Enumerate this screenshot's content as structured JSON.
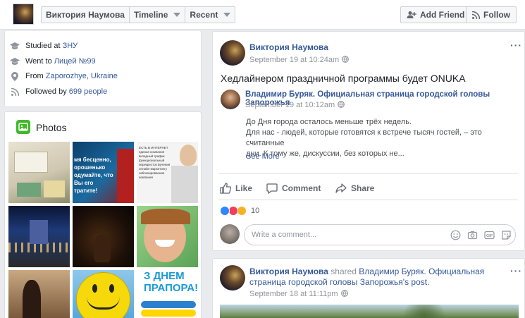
{
  "topbar": {
    "name": "Виктория Наумова",
    "timeline": "Timeline",
    "recent": "Recent",
    "add_friend": "Add Friend",
    "follow": "Follow"
  },
  "intro": {
    "studied_prefix": "Studied at ",
    "studied_link": "ЗНУ",
    "went_prefix": "Went to ",
    "went_link": "Лицей №99",
    "from_prefix": "From ",
    "from_link": "Zaporozhye, Ukraine",
    "followed_prefix": "Followed by ",
    "followed_link": "699 people"
  },
  "photos": {
    "title": "Photos",
    "tile_texts": {
      "t2": "мя бесценно, орошенько одумайте, что Вы его тратите!",
      "t3": "ЕСТЬ В ИНТЕРНЕТ единая компания вкладный график функциональный перекресток Бучения онлайн-маркетингу заблокированная компания",
      "t9": "З ДНЕМ ПРАПОРА!"
    }
  },
  "post1": {
    "author": "Виктория Наумова",
    "time": "September 19 at 10:24am",
    "text": "Хедлайнером праздничной программы будет ONUKA",
    "shared_author": "Владимир Буряк. Официальная страница городской головы Запорожья",
    "shared_time": "September 19 at 10:12am",
    "shared_text_1": "До Дня города осталось меньше трёх недель.",
    "shared_text_2": "Для нас - людей, которые готовятся к встрече тысяч гостей, – это считанные",
    "shared_text_3": "дни. К тому же, дискуссии, без которых не...",
    "see_more": "See More",
    "like": "Like",
    "comment": "Comment",
    "share": "Share",
    "reactions_count": "10",
    "comment_placeholder": "Write a comment..."
  },
  "post2": {
    "author": "Виктория Наумова",
    "shared_word": " shared ",
    "shared_page_1": "Владимир Буряк. Официальная",
    "shared_page_2": "страница городской головы Запорожья",
    "post_suffix": "'s post.",
    "post_link": "post",
    "time": "September 18 at 11:11pm"
  },
  "colors": {
    "link": "#365899",
    "meta": "#90949c",
    "bg": "#e9ebee",
    "like_blue": "#2d88ff",
    "love_red": "#f33e58",
    "wow_yellow": "#f7b125"
  },
  "icons": [
    "cap-icon",
    "pin-icon",
    "rss-icon",
    "photos-icon",
    "globe-icon",
    "like-icon",
    "comment-icon",
    "share-icon",
    "emoji-icon",
    "camera-icon",
    "gif-icon",
    "sticker-icon",
    "more-icon",
    "add-friend-icon",
    "follow-icon"
  ]
}
